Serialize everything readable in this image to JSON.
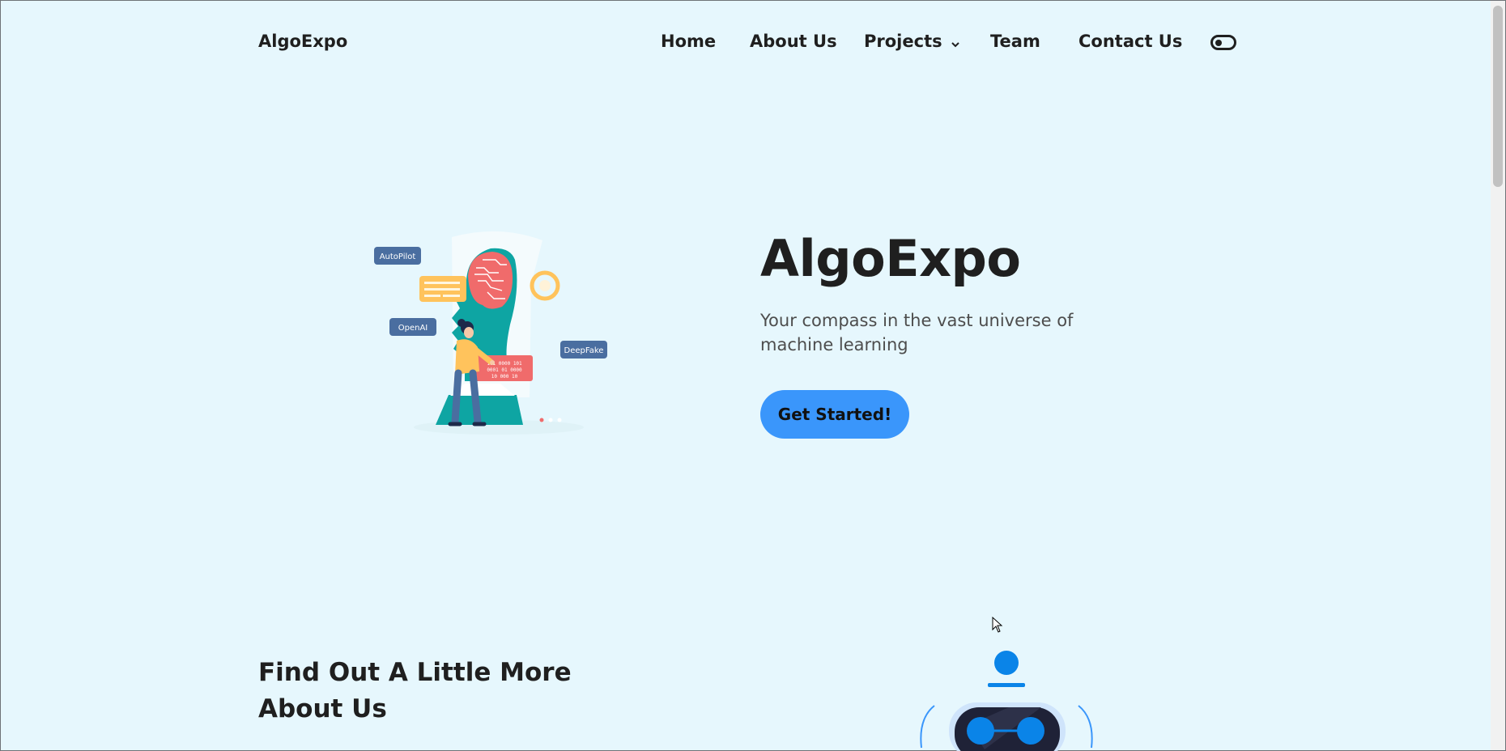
{
  "navbar": {
    "brand": "AlgoExpo",
    "items": [
      {
        "label": "Home"
      },
      {
        "label": "About Us"
      },
      {
        "label": "Projects"
      },
      {
        "label": "Team"
      },
      {
        "label": "Contact Us"
      }
    ],
    "theme_toggle_icon": "toggle-icon"
  },
  "hero": {
    "title": "AlgoExpo",
    "subtitle": "Your compass in the vast universe of machine learning",
    "cta_label": "Get Started!",
    "illustration": {
      "tags": [
        "AutoPilot",
        "OpenAI",
        "DeepFake"
      ],
      "binary_lines": [
        "101 0000 101",
        "0001 01 0000",
        "10  000 10"
      ]
    }
  },
  "about": {
    "heading": "Find Out A Little More About Us"
  },
  "colors": {
    "background": "#e6f7fd",
    "accent": "#3a96fb",
    "text": "#1f1f1f",
    "teal": "#0ea5a3",
    "coral": "#f06b6b",
    "yellow": "#ffc35c",
    "tag": "#4a6ea0"
  }
}
